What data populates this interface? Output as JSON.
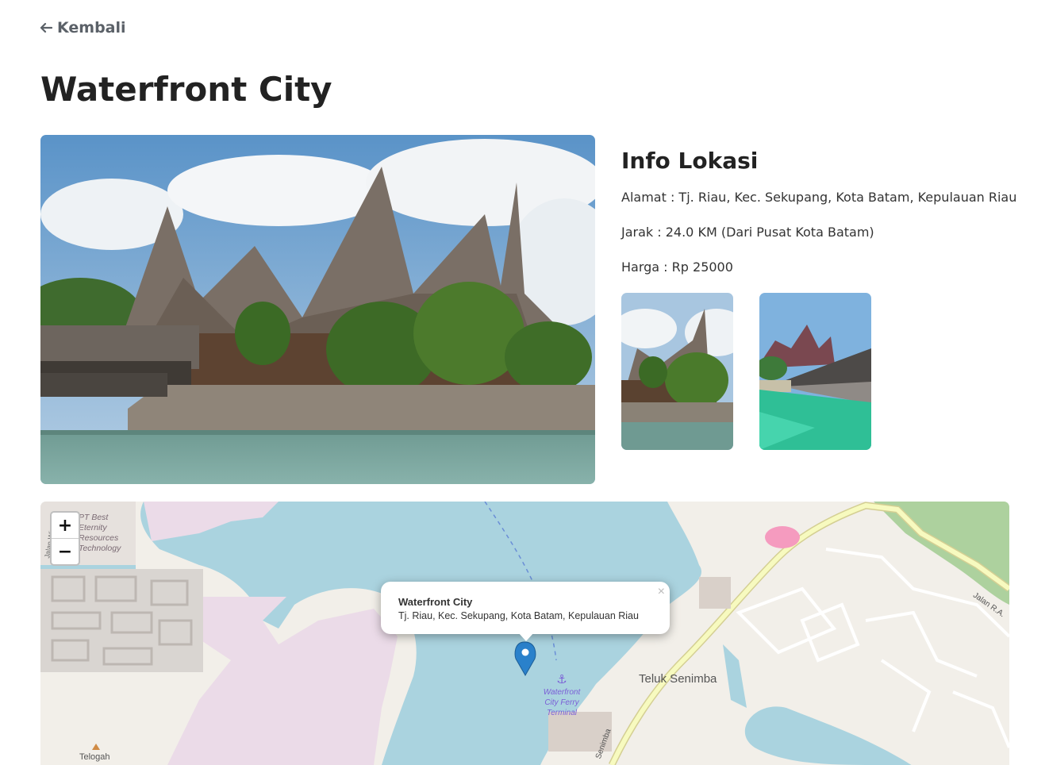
{
  "nav": {
    "back_label": "Kembali"
  },
  "page": {
    "title": "Waterfront City"
  },
  "info": {
    "heading": "Info Lokasi",
    "address": "Alamat : Tj. Riau, Kec. Sekupang, Kota Batam, Kepulauan Riau",
    "distance": "Jarak : 24.0 KM (Dari Pusat Kota Batam)",
    "price": "Harga : Rp 25000"
  },
  "map": {
    "zoom_in": "+",
    "zoom_out": "−",
    "popup": {
      "title": "Waterfront City",
      "address": "Tj. Riau, Kec. Sekupang, Kota Batam, Kepulauan Riau",
      "close": "×"
    },
    "labels": {
      "company": [
        "PT Best",
        "Eternity",
        "Resources",
        "Technology"
      ],
      "bay": "Teluk Senimba",
      "ferry": [
        "Waterfront",
        "City Ferry",
        "Terminal"
      ],
      "road_east": "Jalan R.A.",
      "road_south": "Senimba",
      "road_west": "Jalan Wiseso",
      "village": "Telogah"
    }
  },
  "colors": {
    "water": "#aad3df",
    "land": "#f2efe9",
    "industrial": "#ebdbe8",
    "forest": "#add19e",
    "road_major": "#f7fabf",
    "marker": "#2a81cb"
  }
}
